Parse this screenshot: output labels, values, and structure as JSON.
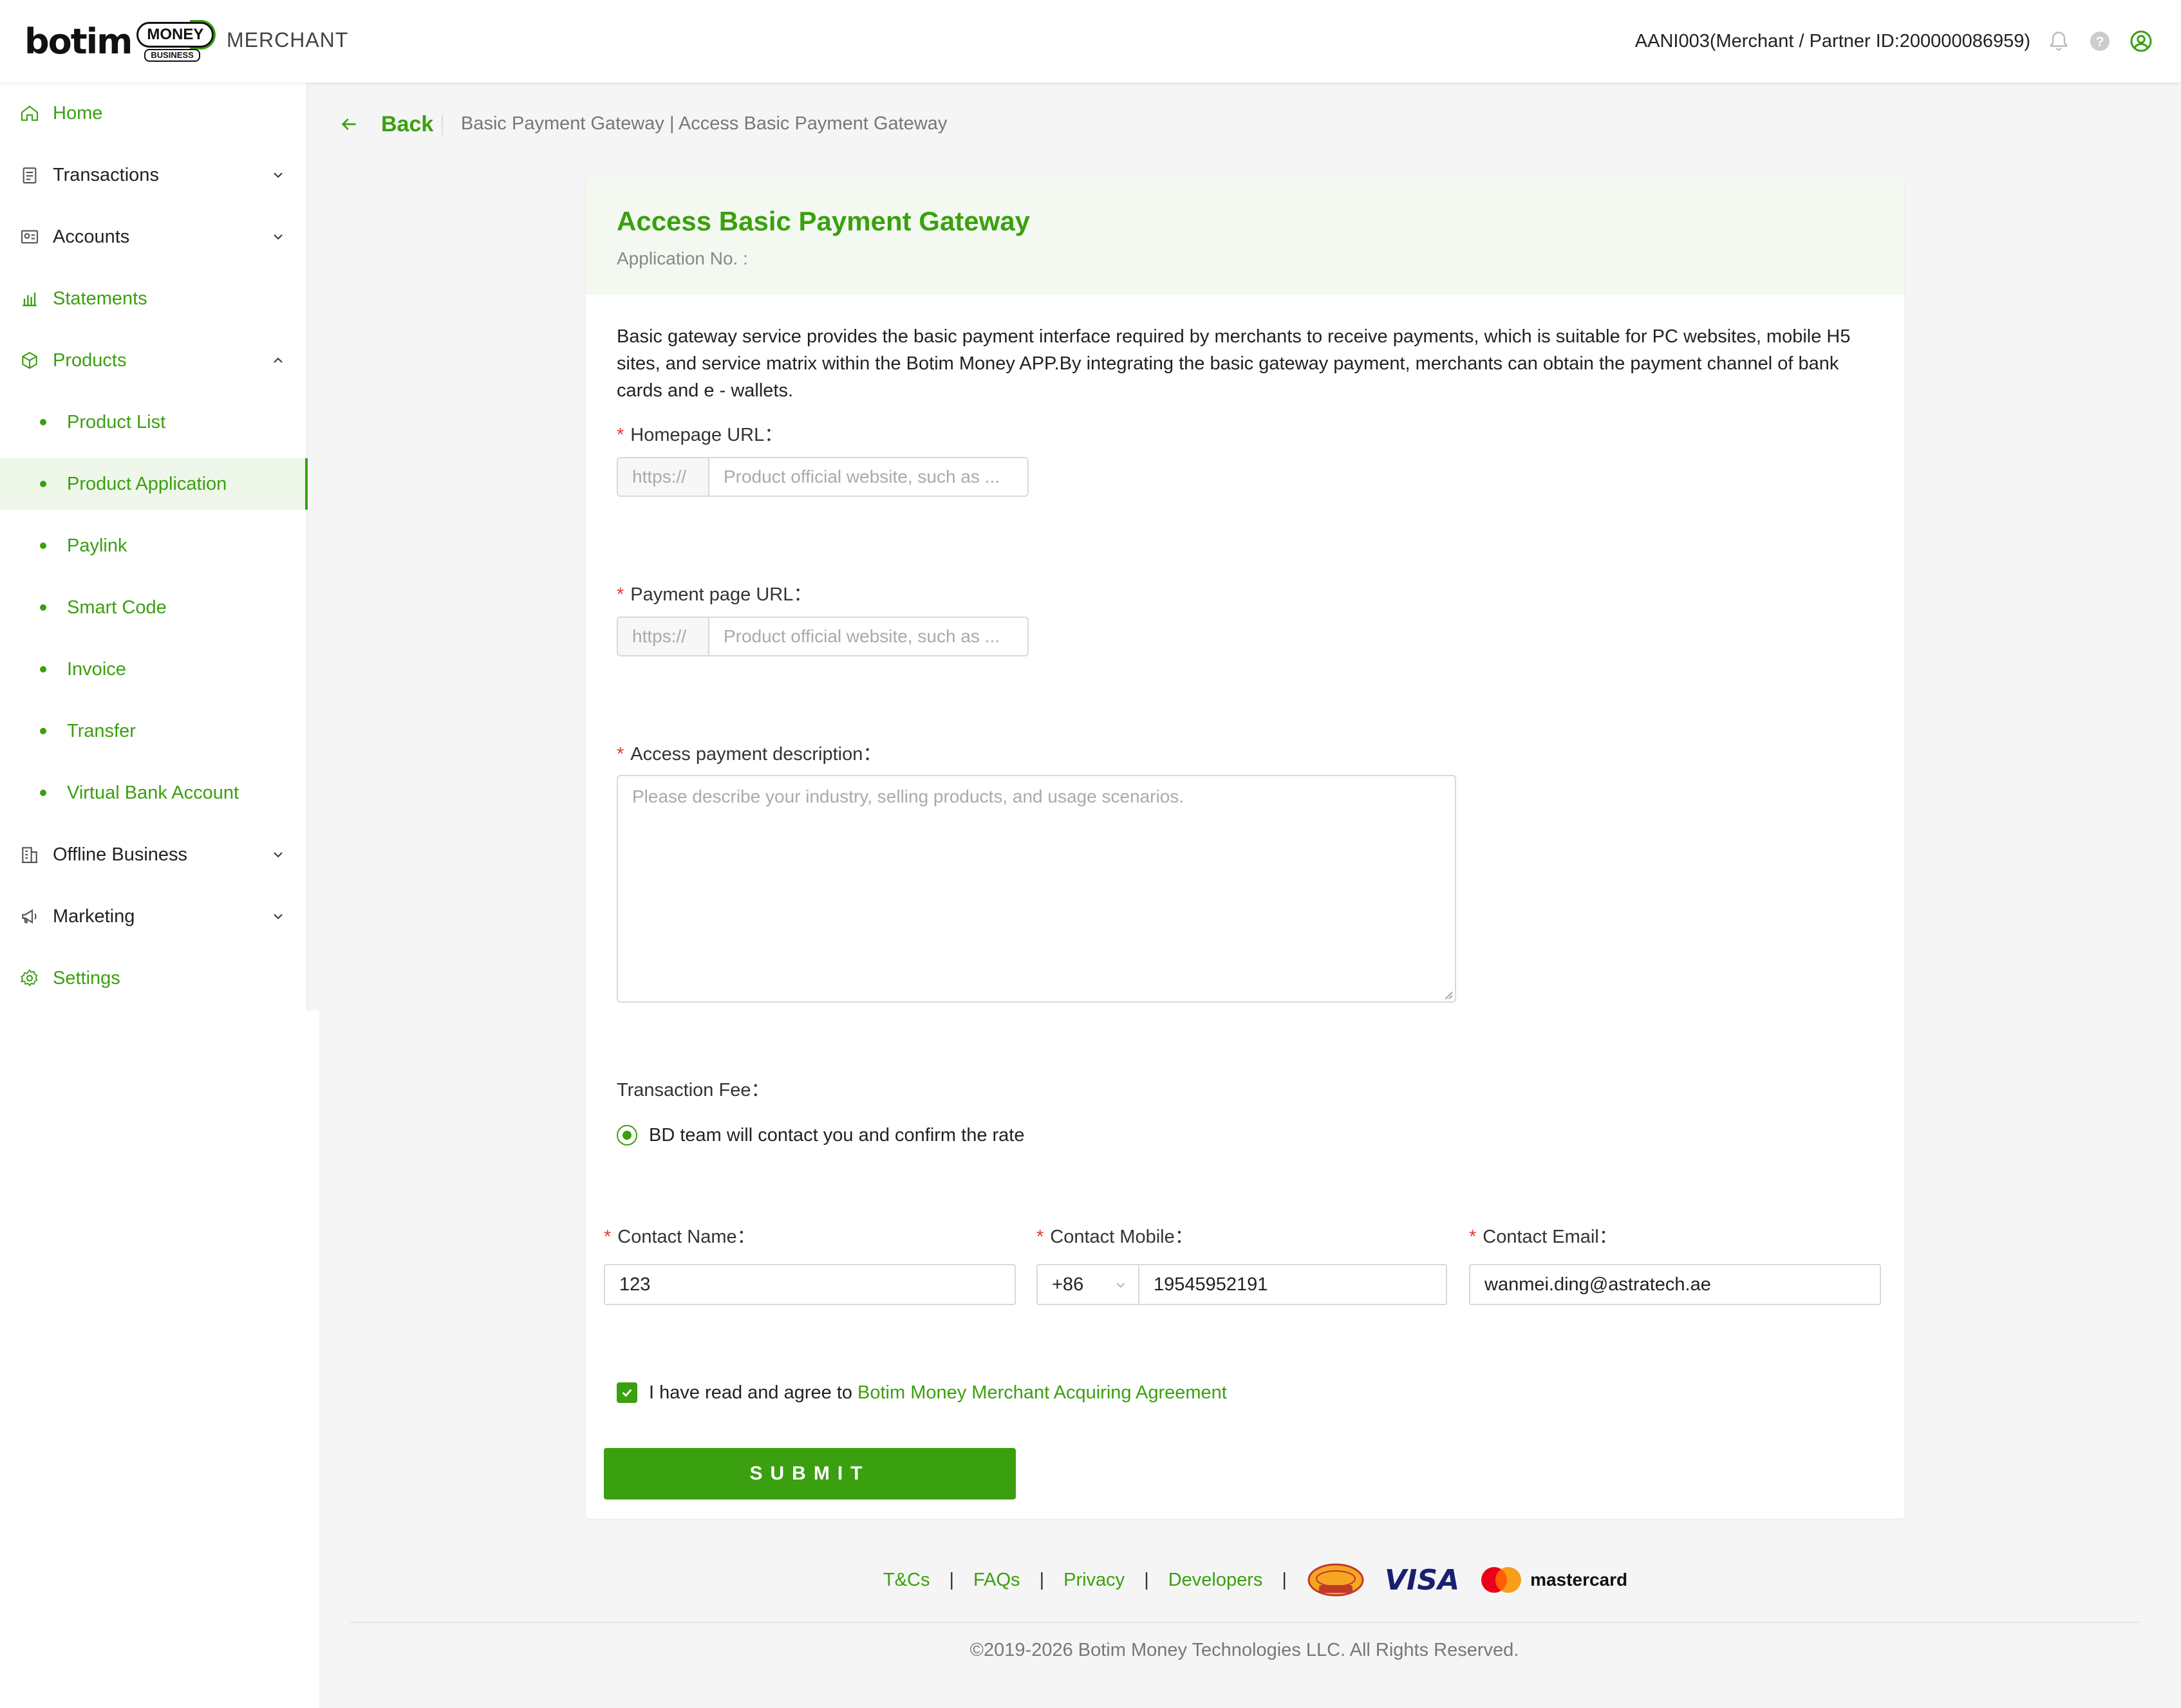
{
  "header": {
    "logo_text": "botim",
    "logo_badge": "MONEY",
    "logo_sub": "BUSINESS",
    "app_label": "MERCHANT",
    "user": "AANI003(Merchant / Partner ID:200000086959)",
    "icons": [
      "bell-icon",
      "help-icon",
      "user-icon"
    ]
  },
  "sidebar": {
    "items": [
      {
        "label": "Home",
        "icon": "home-icon"
      },
      {
        "label": "Transactions",
        "icon": "transactions-icon"
      },
      {
        "label": "Accounts",
        "icon": "accounts-icon"
      },
      {
        "label": "Statements",
        "icon": "statements-icon"
      },
      {
        "label": "Products",
        "icon": "products-icon"
      },
      {
        "label": "Offline Business",
        "icon": "offline-business-icon"
      },
      {
        "label": "Marketing",
        "icon": "marketing-icon"
      },
      {
        "label": "Settings",
        "icon": "settings-icon"
      }
    ],
    "product_subitems": [
      {
        "label": "Product List"
      },
      {
        "label": "Product Application",
        "active": true
      },
      {
        "label": "Paylink"
      },
      {
        "label": "Smart Code"
      },
      {
        "label": "Invoice"
      },
      {
        "label": "Transfer"
      },
      {
        "label": "Virtual Bank Account"
      }
    ]
  },
  "nav": {
    "back_label": "Back",
    "breadcrumb": "Basic Payment Gateway | Access Basic Payment Gateway"
  },
  "form": {
    "title": "Access Basic Payment Gateway",
    "application_no_label": "Application No. :",
    "description": "Basic gateway service provides the basic payment interface required by merchants to receive payments, which is suitable for PC websites, mobile H5 sites, and service matrix within the Botim Money APP.By integrating the basic gateway payment, merchants can obtain the payment channel of bank cards and e - wallets.",
    "homepage_url_label": "Homepage URL：",
    "payment_page_url_label": "Payment page URL：",
    "url_prefix": "https://",
    "url_placeholder": "Product official website, such as ...",
    "access_desc_label": "Access payment description：",
    "access_desc_placeholder": "Please describe your industry, selling products, and usage scenarios.",
    "transaction_fee_label": "Transaction Fee：",
    "fee_option": "BD team will contact you and confirm the rate",
    "contact_name_label": "Contact Name：",
    "contact_name_value": "123",
    "contact_mobile_label": "Contact Mobile：",
    "mobile_code": "+86",
    "contact_mobile_value": "19545952191",
    "contact_email_label": "Contact Email：",
    "contact_email_value": "wanmei.ding@astratech.ae",
    "required_mark": "*",
    "agree_text": "I have read and agree to",
    "agree_link": "Botim Money Merchant Acquiring Agreement",
    "submit_label": "SUBMIT"
  },
  "footer": {
    "links": [
      "T&Cs",
      "FAQs",
      "Privacy",
      "Developers"
    ],
    "separator": "|",
    "payment_logos": [
      "aani-logo",
      "visa-logo",
      "mastercard-logo"
    ],
    "visa_text": "VISA",
    "mastercard_text": "mastercard",
    "copyright": "©2019-2026 Botim Money Technologies LLC. All Rights Reserved."
  },
  "colors": {
    "brand_green": "#3aa00f",
    "required_red": "#e53935",
    "header_bg": "#f3f9f0"
  }
}
